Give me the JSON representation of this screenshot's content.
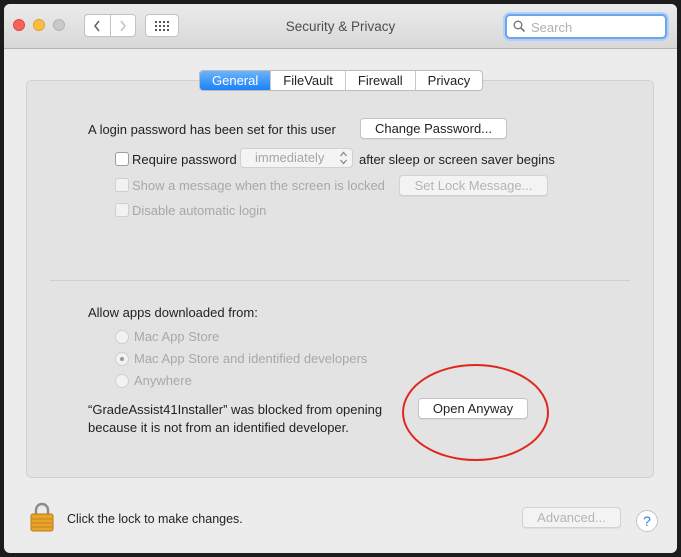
{
  "window": {
    "title": "Security & Privacy"
  },
  "search": {
    "placeholder": "Search",
    "value": ""
  },
  "tabs": [
    {
      "label": "General",
      "active": true
    },
    {
      "label": "FileVault",
      "active": false
    },
    {
      "label": "Firewall",
      "active": false
    },
    {
      "label": "Privacy",
      "active": false
    }
  ],
  "general": {
    "login_password_text": "A login password has been set for this user",
    "change_password_label": "Change Password...",
    "require_password_label": "Require password",
    "require_password_value": "immediately",
    "require_password_suffix": "after sleep or screen saver begins",
    "show_message_label": "Show a message when the screen is locked",
    "set_lock_message_label": "Set Lock Message...",
    "disable_auto_login_label": "Disable automatic login",
    "allow_apps_label": "Allow apps downloaded from:",
    "radio_options": [
      {
        "label": "Mac App Store",
        "selected": false
      },
      {
        "label": "Mac App Store and identified developers",
        "selected": true
      },
      {
        "label": "Anywhere",
        "selected": false
      }
    ],
    "blocked_line1": "“GradeAssist41Installer” was blocked from opening",
    "blocked_line2": "because it is not from an identified developer.",
    "open_anyway_label": "Open Anyway"
  },
  "footer": {
    "lock_text": "Click the lock to make changes.",
    "advanced_label": "Advanced...",
    "help_label": "?"
  },
  "colors": {
    "accent": "#1a82fb",
    "annotation_ring": "#e0271b"
  },
  "icons": [
    "search-icon",
    "back-chevron-icon",
    "forward-chevron-icon",
    "grid-icon",
    "lock-icon",
    "help-icon",
    "popup-arrows-icon"
  ]
}
